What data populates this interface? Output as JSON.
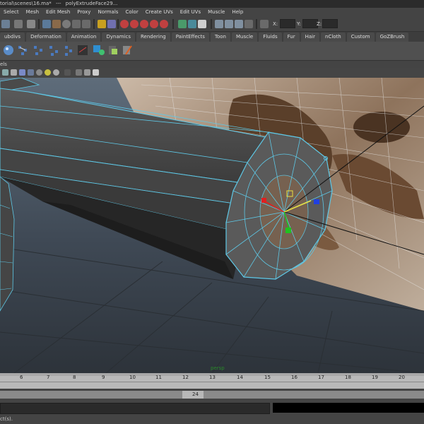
{
  "titlebar": {
    "path": "torial\\scenes\\16.ma*",
    "separator": "---",
    "selection": "polyExtrudeFace29..."
  },
  "menu": [
    "Select",
    "Mesh",
    "Edit Mesh",
    "Proxy",
    "Normals",
    "Color",
    "Create UVs",
    "Edit UVs",
    "Muscle",
    "Help"
  ],
  "statusline": {
    "x_label": "X:",
    "y_label": "Y:",
    "z_label": "Z:",
    "x_value": "",
    "y_value": "",
    "z_value": ""
  },
  "shelf_tabs": [
    "ubdivs",
    "Deformation",
    "Animation",
    "Dynamics",
    "Rendering",
    "PaintEffects",
    "Toon",
    "Muscle",
    "Fluids",
    "Fur",
    "Hair",
    "nCloth",
    "Custom",
    "GoZBrush"
  ],
  "panel": {
    "menu_fragment": "els"
  },
  "viewport": {
    "axis_label": "persp"
  },
  "timeslider": {
    "ticks": [
      "6",
      "7",
      "8",
      "9",
      "10",
      "11",
      "12",
      "13",
      "14",
      "15",
      "16",
      "17",
      "18",
      "19",
      "20"
    ],
    "current_frame": "24"
  },
  "cmdline": {
    "prompt": ""
  },
  "helpline": {
    "text": "ct(s)."
  },
  "colors": {
    "ui_bg": "#444444",
    "wire": "#5ec8e6",
    "mesh_face": "#4f4f4f",
    "manip_x": "#e02020",
    "manip_y": "#20c020",
    "manip_z": "#2040e0",
    "manip_center": "#e8e040"
  },
  "icons": [
    "select-tool-icon",
    "lasso-tool-icon",
    "paint-select-icon",
    "move-tool-icon",
    "rotate-tool-icon",
    "scale-tool-icon",
    "snap-grid-icon",
    "snap-curve-icon",
    "snap-point-icon",
    "snap-plane-icon",
    "render-icon",
    "ipr-render-icon",
    "render-settings-icon",
    "shelf-mesh-icon",
    "camera-icon",
    "light-icon",
    "wireframe-icon",
    "smooth-shade-icon",
    "texture-icon"
  ]
}
